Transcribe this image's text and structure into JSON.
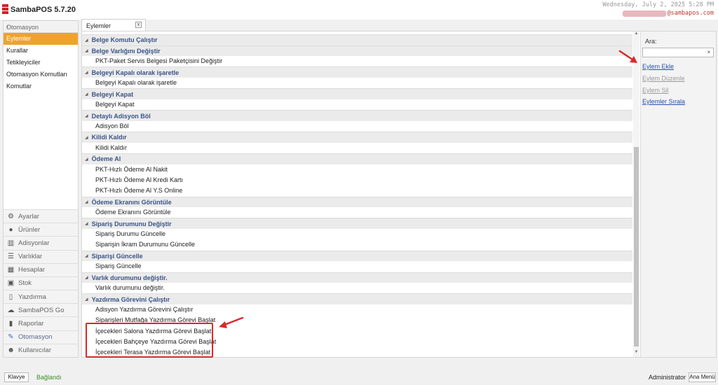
{
  "app": {
    "title": "SambaPOS 5.7.20"
  },
  "header": {
    "datetime": "Wednesday, July 2, 2025 5:28 PM",
    "email_suffix": "@sambapos.com"
  },
  "sidebar": {
    "header": "Otomasyon",
    "items": [
      {
        "label": "Eylemler",
        "active": true
      },
      {
        "label": "Kurallar"
      },
      {
        "label": "Tetikleyiciler"
      },
      {
        "label": "Otomasyon Komutları"
      },
      {
        "label": "Komutlar"
      }
    ]
  },
  "nav": {
    "items": [
      {
        "label": "Ayarlar",
        "icon": "gear-icon"
      },
      {
        "label": "Ürünler",
        "icon": "apple-icon"
      },
      {
        "label": "Adisyonlar",
        "icon": "books-icon"
      },
      {
        "label": "Varlıklar",
        "icon": "list-icon"
      },
      {
        "label": "Hesaplar",
        "icon": "calculator-icon"
      },
      {
        "label": "Stok",
        "icon": "box-icon"
      },
      {
        "label": "Yazdırma",
        "icon": "document-icon"
      },
      {
        "label": "SambaPOS Go",
        "icon": "cloud-icon"
      },
      {
        "label": "Raporlar",
        "icon": "bar-chart-icon"
      },
      {
        "label": "Otomasyon",
        "icon": "pen-icon",
        "active": true
      },
      {
        "label": "Kullanıcılar",
        "icon": "user-icon"
      }
    ]
  },
  "tab": {
    "label": "Eylemler",
    "close": "x"
  },
  "groups": [
    {
      "title": "Belge Komutu Çalıştır",
      "items": []
    },
    {
      "title": "Belge Varlığını Değiştir",
      "items": [
        "PKT-Paket Servis Belgesi Paketçisini Değiştir"
      ]
    },
    {
      "title": "Belgeyi Kapalı olarak işaretle",
      "items": [
        "Belgeyi Kapalı olarak işaretle"
      ]
    },
    {
      "title": "Belgeyi Kapat",
      "items": [
        "Belgeyi Kapat"
      ]
    },
    {
      "title": "Detaylı Adisyon Böl",
      "items": [
        "Adisyon Böl"
      ]
    },
    {
      "title": "Kilidi Kaldır",
      "items": [
        "Kilidi Kaldır"
      ]
    },
    {
      "title": "Ödeme Al",
      "items": [
        "PKT-Hızlı Ödeme Al Nakit",
        "PKT-Hızlı Ödeme Al Kredi Kartı",
        "PKT-Hızlı Ödeme Al Y.S Online"
      ]
    },
    {
      "title": "Ödeme Ekranını Görüntüle",
      "items": [
        "Ödeme Ekranını Görüntüle"
      ]
    },
    {
      "title": "Sipariş Durumunu Değiştir",
      "items": [
        "Sipariş Durumu Güncelle",
        "Siparişin İkram Durumunu Güncelle"
      ]
    },
    {
      "title": "Siparişi Güncelle",
      "items": [
        "Sipariş Güncelle"
      ]
    },
    {
      "title": "Varlık durumunu değiştir.",
      "items": [
        "Varlık durumunu değiştir."
      ]
    },
    {
      "title": "Yazdırma Görevini Çalıştır",
      "items": [
        "Adisyon Yazdırma Görevini Çalıştır",
        "Siparişleri Mutfağa Yazdırma Görevi Başlat",
        "İçecekleri Salona Yazdırma Görevi Başlat",
        "İçecekleri Bahçeye Yazdırma Görevi Başlat",
        "İçecekleri Terasa Yazdırma Görevi Başlat"
      ]
    }
  ],
  "right_panel": {
    "search_label": "Ara:",
    "search_value": "",
    "search_clear": "×",
    "actions": [
      {
        "label": "Eylem Ekle",
        "enabled": true
      },
      {
        "label": "Eylem Düzenle",
        "enabled": false
      },
      {
        "label": "Eylem Sil",
        "enabled": false
      },
      {
        "label": "Eylemler Sırala",
        "enabled": true
      }
    ]
  },
  "status": {
    "keyboard_button": "Klavye",
    "connection": "Bağlandı",
    "user": "Administrator",
    "main_menu_button": "Ana Menü"
  },
  "colors": {
    "accent": "#f0a22e",
    "group_title": "#3a5487",
    "annotation": "#d92a2a",
    "connected": "#3c8f2c"
  }
}
